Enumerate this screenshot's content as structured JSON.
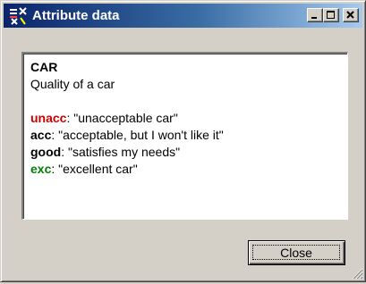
{
  "window": {
    "title": "Attribute data",
    "app_icon": "decision-tree-icon",
    "controls": {
      "minimize_icon": "minimize-icon",
      "maximize_icon": "maximize-icon",
      "close_icon": "close-icon"
    }
  },
  "attribute": {
    "name": "CAR",
    "description": "Quality of a car",
    "values": [
      {
        "name": "unacc",
        "description": ": \"unacceptable car\"",
        "color": "#cc0000"
      },
      {
        "name": "acc",
        "description": ": \"acceptable, but I won't like it\"",
        "color": "#000000"
      },
      {
        "name": "good",
        "description": ": \"satisfies my needs\"",
        "color": "#000000"
      },
      {
        "name": "exc",
        "description": ": \"excellent car\"",
        "color": "#008000"
      }
    ]
  },
  "buttons": {
    "close_label": "Close"
  },
  "colors": {
    "titlebar_start": "#0a246a",
    "titlebar_end": "#a6caf0",
    "window_bg": "#d4d0c8"
  }
}
